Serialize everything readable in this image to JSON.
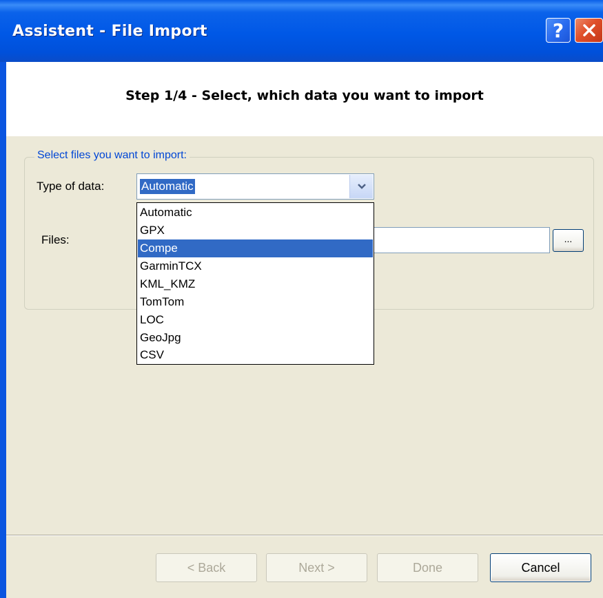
{
  "window": {
    "title": "Assistent - File Import",
    "help_label": "?",
    "close_label": "✕"
  },
  "header": {
    "step_title": "Step 1/4 - Select, which data you want to import"
  },
  "group": {
    "legend": "Select files you want to import:",
    "type_label": "Type of data:",
    "type_value": "Automatic",
    "files_label": "Files:",
    "files_value": "",
    "browse_label": "..."
  },
  "dropdown": {
    "options": [
      "Automatic",
      "GPX",
      "Compe",
      "GarminTCX",
      "KML_KMZ",
      "TomTom",
      "LOC",
      "GeoJpg",
      "CSV"
    ],
    "highlighted": "Compe"
  },
  "buttons": {
    "back": "< Back",
    "next": "Next >",
    "done": "Done",
    "cancel": "Cancel"
  },
  "colors": {
    "titlebar": "#0058e6",
    "selection": "#316ac5",
    "legend_text": "#0046d5",
    "dialog_bg": "#ece9d8"
  }
}
